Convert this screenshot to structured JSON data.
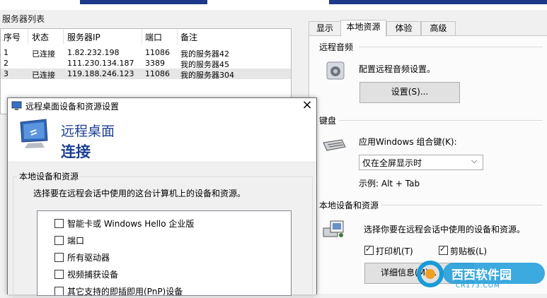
{
  "server_list": {
    "title": "服务器列表",
    "columns": [
      "序号",
      "状态",
      "服务器IP",
      "端口",
      "备注"
    ],
    "rows": [
      {
        "index": "1",
        "status": "已连接",
        "ip": "1.82.232.198",
        "port": "11086",
        "note": "我的服务器42"
      },
      {
        "index": "2",
        "status": "",
        "ip": "111.230.134.187",
        "port": "3389",
        "note": "我的服务器45"
      },
      {
        "index": "3",
        "status": "已连接",
        "ip": "119.188.246.123",
        "port": "11086",
        "note": "我的服务器304"
      }
    ]
  },
  "settings": {
    "tabs": [
      "显示",
      "本地资源",
      "体验",
      "高级"
    ],
    "active_tab": "本地资源",
    "audio": {
      "title": "远程音频",
      "desc": "配置远程音频设置。",
      "button": "设置(S)..."
    },
    "keyboard": {
      "title": "键盘",
      "label": "应用Windows 组合键(K):",
      "selected": "仅在全屏显示时",
      "example": "示例: Alt + Tab"
    },
    "local": {
      "title": "本地设备和资源",
      "desc": "选择你要在远程会话中使用的设备和资源。",
      "printer": "打印机(T)",
      "clipboard": "剪贴板(L)",
      "details_button": "详细信息(M)..."
    }
  },
  "dialog": {
    "title": "远程桌面设备和资源设置",
    "heading_line1": "远程桌面",
    "heading_line2": "连接",
    "group_title": "本地设备和资源",
    "instruction": "选择要在远程会话中使用的这台计算机上的设备和资源。",
    "items": [
      "智能卡或 Windows Hello 企业版",
      "端口",
      "所有驱动器",
      "视频捕获设备",
      "其它支持的即插即用(PnP)设备"
    ],
    "close_symbol": "×"
  },
  "watermark": {
    "text": "西西软件园",
    "sub": "CR173.COM"
  },
  "colors": {
    "accent": "#1c3f94",
    "selected_row": "#e6e6e6"
  }
}
